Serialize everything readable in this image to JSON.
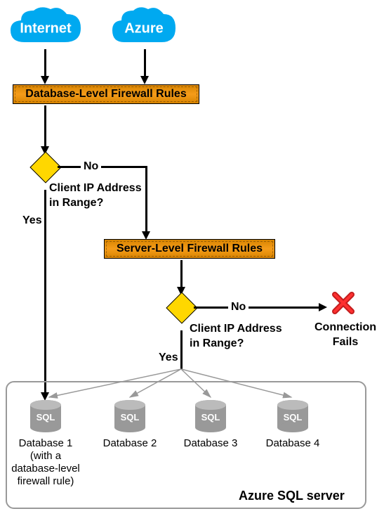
{
  "clouds": {
    "internet": "Internet",
    "azure": "Azure"
  },
  "boxes": {
    "db_firewall": "Database-Level Firewall Rules",
    "server_firewall": "Server-Level Firewall Rules"
  },
  "decisions": {
    "question": "Client IP Address\nin Range?",
    "yes": "Yes",
    "no": "No"
  },
  "fail": "Connection\nFails",
  "server": {
    "title": "Azure SQL server",
    "db_text": "SQL",
    "databases": [
      {
        "name": "Database 1",
        "subtitle": "(with a\ndatabase-level\nfirewall rule)"
      },
      {
        "name": "Database 2",
        "subtitle": ""
      },
      {
        "name": "Database 3",
        "subtitle": ""
      },
      {
        "name": "Database 4",
        "subtitle": ""
      }
    ]
  }
}
